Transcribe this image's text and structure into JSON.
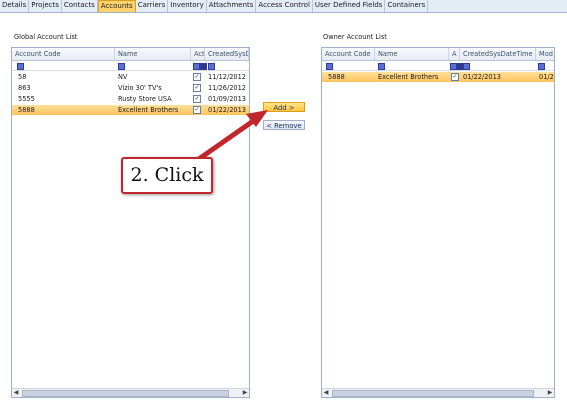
{
  "tabs": [
    "Details",
    "Projects",
    "Contacts",
    "Accounts",
    "Carriers",
    "Inventory",
    "Attachments",
    "Access Control",
    "User Defined Fields",
    "Containers"
  ],
  "active_tab": "Accounts",
  "global": {
    "title": "Global Account List",
    "headers": [
      "Account Code",
      "Name",
      "Act",
      "CreatedSysD"
    ],
    "rows": [
      {
        "code": "58",
        "name": "NV",
        "date": "11/12/2012"
      },
      {
        "code": "863",
        "name": "Vizio 30' TV's",
        "date": "11/26/2012"
      },
      {
        "code": "5555",
        "name": "Rusty Store USA",
        "date": "01/09/2013"
      },
      {
        "code": "5888",
        "name": "Excellent Brothers",
        "date": "01/22/2013"
      }
    ],
    "selected_row": 3
  },
  "owner": {
    "title": "Owner Account List",
    "headers": [
      "Account Code",
      "Name",
      "A",
      "CreatedSysDateTime",
      "Mod"
    ],
    "rows": [
      {
        "code": "5888",
        "name": "Excellent Brothers",
        "date": "01/22/2013",
        "mod": "01/22"
      }
    ]
  },
  "buttons": {
    "add": "Add >",
    "remove": "< Remove"
  },
  "annotation": {
    "text": "2. Click"
  },
  "colors": {
    "arrow": "#c0262c",
    "selection": "#ffc35a",
    "active_tab": "#ffd36b"
  }
}
